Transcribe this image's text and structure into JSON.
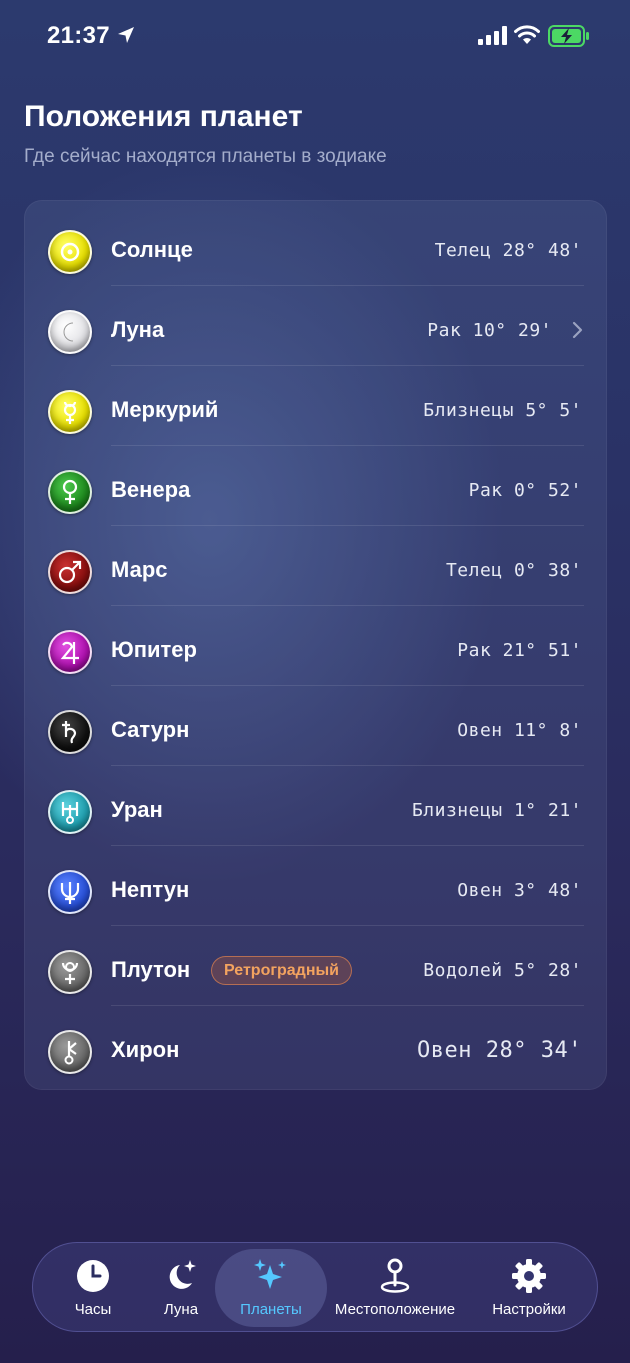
{
  "status_bar": {
    "time": "21:37"
  },
  "header": {
    "title": "Положения планет",
    "subtitle": "Где сейчас находятся планеты в зодиаке"
  },
  "planets": [
    {
      "name": "Солнце",
      "position": "Телец 28° 48'",
      "icon": "sun-icon",
      "color": "#e8e000"
    },
    {
      "name": "Луна",
      "position": "Рак 10° 29'",
      "icon": "moon-icon",
      "color": "#e8e8ea"
    },
    {
      "name": "Меркурий",
      "position": "Близнецы 5° 5'",
      "icon": "mercury-icon",
      "color": "#e8e000"
    },
    {
      "name": "Венера",
      "position": "Рак 0° 52'",
      "icon": "venus-icon",
      "color": "#1e8a1e"
    },
    {
      "name": "Марс",
      "position": "Телец 0° 38'",
      "icon": "mars-icon",
      "color": "#8a0f0f"
    },
    {
      "name": "Юпитер",
      "position": "Рак 21° 51'",
      "icon": "jupiter-icon",
      "color": "#b010b0"
    },
    {
      "name": "Сатурн",
      "position": "Овен 11° 8'",
      "icon": "saturn-icon",
      "color": "#111111"
    },
    {
      "name": "Уран",
      "position": "Близнецы 1° 21'",
      "icon": "uranus-icon",
      "color": "#20a0b0"
    },
    {
      "name": "Нептун",
      "position": "Овен 3° 48'",
      "icon": "neptune-icon",
      "color": "#2850d8"
    },
    {
      "name": "Плутон",
      "position": "Водолей 5° 28'",
      "icon": "pluto-icon",
      "color": "#6a6a6a",
      "badge": "Ретроградный"
    },
    {
      "name": "Хирон",
      "position": "Овен 28° 34'",
      "icon": "chiron-icon",
      "color": "#6a6a6a"
    }
  ],
  "tabs": [
    {
      "label": "Часы",
      "icon": "clock-icon"
    },
    {
      "label": "Луна",
      "icon": "moon-stars-icon"
    },
    {
      "label": "Планеты",
      "icon": "sparkles-icon",
      "active": true
    },
    {
      "label": "Местоположение",
      "icon": "map-pin-icon"
    },
    {
      "label": "Настройки",
      "icon": "gear-icon"
    }
  ],
  "colors": {
    "accent": "#55c8ff",
    "retrograde": "#f3a35f"
  }
}
